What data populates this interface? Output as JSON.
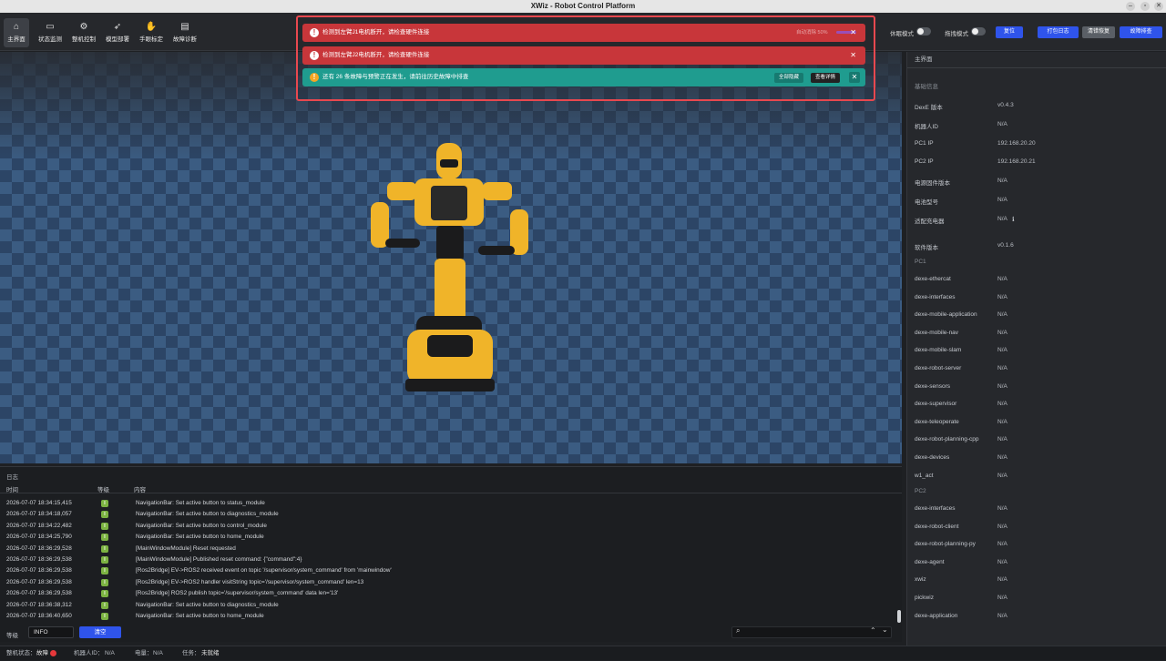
{
  "window": {
    "title": "XWiz - Robot Control Platform"
  },
  "nav": {
    "items": [
      {
        "label": "主界面",
        "icon": "home-icon",
        "active": true
      },
      {
        "label": "状态监测",
        "icon": "monitor-icon"
      },
      {
        "label": "整机控制",
        "icon": "robot-control-icon"
      },
      {
        "label": "模型部署",
        "icon": "rocket-icon"
      },
      {
        "label": "手眼标定",
        "icon": "hand-eye-icon"
      },
      {
        "label": "故障诊断",
        "icon": "diagnosis-icon"
      }
    ]
  },
  "toolbar_right": {
    "sleep_mode": "休眠模式",
    "drag_mode": "拖拽模式",
    "reset": "复位",
    "pack_logs": "打包日志",
    "clear_faults": "清错恢复",
    "fault_check": "故障排查"
  },
  "notifications": [
    {
      "text": "检测到左臂J1电机断开，请检查硬件连接",
      "extra": "自动消除 50%",
      "type": "error"
    },
    {
      "text": "检测到左臂J2电机断开，请检查硬件连接",
      "type": "error"
    },
    {
      "text": "还有 26 条故障与预警正在发生，请前往历史故障中排查",
      "type": "warning",
      "hide_all": "全部隐藏",
      "view_details": "查看详情"
    }
  ],
  "side_panel": {
    "header": "主界面",
    "basic_info_title": "基础信息",
    "basic_info": [
      {
        "k": "DexE 版本",
        "v": "v0.4.3"
      },
      {
        "k": "机器人ID",
        "v": "N/A"
      },
      {
        "k": "PC1 IP",
        "v": "192.168.20.20"
      },
      {
        "k": "PC2 IP",
        "v": "192.168.20.21"
      },
      {
        "k": "电源固件版本",
        "v": "N/A"
      },
      {
        "k": "电池型号",
        "v": "N/A"
      },
      {
        "k": "适配充电器",
        "v": "N/A"
      }
    ],
    "software_version_label": "软件版本",
    "software_version": "v0.1.6",
    "pc1_label": "PC1",
    "pc1": [
      {
        "k": "dexe-ethercat",
        "v": "N/A"
      },
      {
        "k": "dexe-interfaces",
        "v": "N/A"
      },
      {
        "k": "dexe-mobile-application",
        "v": "N/A"
      },
      {
        "k": "dexe-mobile-nav",
        "v": "N/A"
      },
      {
        "k": "dexe-mobile-slam",
        "v": "N/A"
      },
      {
        "k": "dexe-robot-server",
        "v": "N/A"
      },
      {
        "k": "dexe-sensors",
        "v": "N/A"
      },
      {
        "k": "dexe-supervisor",
        "v": "N/A"
      },
      {
        "k": "dexe-teleoperate",
        "v": "N/A"
      },
      {
        "k": "dexe-robot-planning-cpp",
        "v": "N/A"
      },
      {
        "k": "dexe-devices",
        "v": "N/A"
      },
      {
        "k": "w1_act",
        "v": "N/A"
      }
    ],
    "pc2_label": "PC2",
    "pc2": [
      {
        "k": "dexe-interfaces",
        "v": "N/A"
      },
      {
        "k": "dexe-robot-client",
        "v": "N/A"
      },
      {
        "k": "dexe-robot-planning-py",
        "v": "N/A"
      },
      {
        "k": "dexe-agent",
        "v": "N/A"
      },
      {
        "k": "xwiz",
        "v": "N/A"
      },
      {
        "k": "pickwiz",
        "v": "N/A"
      },
      {
        "k": "dexe-application",
        "v": "N/A"
      }
    ]
  },
  "log": {
    "title": "日志",
    "col_time": "时间",
    "col_level": "等级",
    "col_content": "内容",
    "level_badge": "I",
    "rows": [
      {
        "time": "2026-07-07 18:34:15,415",
        "content": "NavigationBar: Set active button to status_module"
      },
      {
        "time": "2026-07-07 18:34:18,057",
        "content": "NavigationBar: Set active button to diagnostics_module"
      },
      {
        "time": "2026-07-07 18:34:22,482",
        "content": "NavigationBar: Set active button to control_module"
      },
      {
        "time": "2026-07-07 18:34:25,790",
        "content": "NavigationBar: Set active button to home_module"
      },
      {
        "time": "2026-07-07 18:36:29,528",
        "content": "[MainWindowModule] Reset requested"
      },
      {
        "time": "2026-07-07 18:36:29,538",
        "content": "[MainWindowModule] Published reset command: {\"command\":4}"
      },
      {
        "time": "2026-07-07 18:36:29,538",
        "content": "[Ros2Bridge] EV->ROS2 received event on topic '/supervisor/system_command' from 'mainwindow'"
      },
      {
        "time": "2026-07-07 18:36:29,538",
        "content": "[Ros2Bridge] EV->ROS2 handler visitString topic='/supervisor/system_command' len=13"
      },
      {
        "time": "2026-07-07 18:36:29,538",
        "content": "[Ros2Bridge] ROS2 publish topic='/supervisor/system_command' data len='13'"
      },
      {
        "time": "2026-07-07 18:36:38,312",
        "content": "NavigationBar: Set active button to diagnostics_module"
      },
      {
        "time": "2026-07-07 18:36:40,650",
        "content": "NavigationBar: Set active button to home_module"
      }
    ],
    "level_label": "等级",
    "level_value": "INFO",
    "clear": "清空"
  },
  "statusbar": {
    "machine_state_label": "整机状态：",
    "machine_state": "故障",
    "robot_id_label": "机器人ID：",
    "robot_id": "N/A",
    "battery_label": "电量：",
    "battery": "N/A",
    "task_label": "任务：",
    "task": "未就绪"
  },
  "colors": {
    "error": "#c8363a",
    "warning": "#1f9c8f",
    "accent": "#2f54eb",
    "level_info": "#7cb342"
  }
}
